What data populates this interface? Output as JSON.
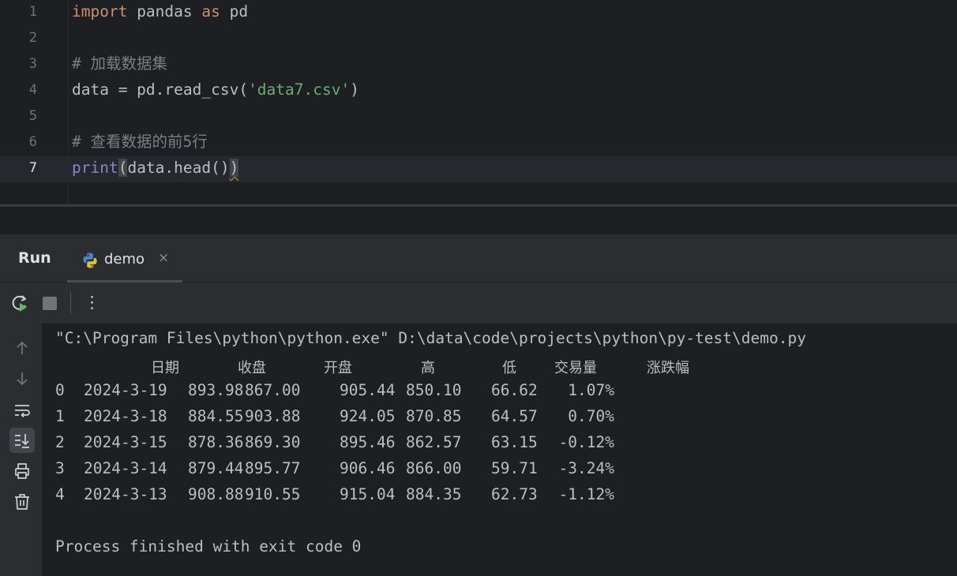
{
  "editor": {
    "lines": [
      {
        "num": "1",
        "tokens": [
          {
            "t": "import",
            "c": "kw"
          },
          {
            "t": " pandas ",
            "c": ""
          },
          {
            "t": "as",
            "c": "kw"
          },
          {
            "t": " pd",
            "c": ""
          }
        ]
      },
      {
        "num": "2",
        "tokens": []
      },
      {
        "num": "3",
        "tokens": [
          {
            "t": "# 加载数据集",
            "c": "comment"
          }
        ]
      },
      {
        "num": "4",
        "tokens": [
          {
            "t": "data = pd.read_csv(",
            "c": ""
          },
          {
            "t": "'data7.csv'",
            "c": "str"
          },
          {
            "t": ")",
            "c": ""
          }
        ]
      },
      {
        "num": "5",
        "tokens": []
      },
      {
        "num": "6",
        "tokens": [
          {
            "t": "# 查看数据的前5行",
            "c": "comment"
          }
        ]
      },
      {
        "num": "7",
        "current": true,
        "tokens": [
          {
            "t": "print",
            "c": "builtin"
          },
          {
            "t": "(",
            "c": "paren-match"
          },
          {
            "t": "data.head()",
            "c": ""
          },
          {
            "t": ")",
            "c": "paren-warn"
          }
        ]
      }
    ]
  },
  "run_panel": {
    "title": "Run",
    "tab_label": "demo",
    "tab_close": "×",
    "more_label": "⋮"
  },
  "console": {
    "command": "\"C:\\Program Files\\python\\python.exe\" D:\\data\\code\\projects\\python\\py-test\\demo.py",
    "headers": [
      "日期",
      "收盘",
      "开盘",
      "高",
      "低",
      "交易量",
      "涨跌幅"
    ],
    "rows": [
      [
        "0",
        "2024-3-19",
        "893.98",
        "867.00",
        "905.44",
        "850.10",
        "66.62",
        "1.07%"
      ],
      [
        "1",
        "2024-3-18",
        "884.55",
        "903.88",
        "924.05",
        "870.85",
        "64.57",
        "0.70%"
      ],
      [
        "2",
        "2024-3-15",
        "878.36",
        "869.30",
        "895.46",
        "862.57",
        "63.15",
        "-0.12%"
      ],
      [
        "3",
        "2024-3-14",
        "879.44",
        "895.77",
        "906.46",
        "866.00",
        "59.71",
        "-3.24%"
      ],
      [
        "4",
        "2024-3-13",
        "908.88",
        "910.55",
        "915.04",
        "884.35",
        "62.73",
        "-1.12%"
      ]
    ],
    "finish_message": "Process finished with exit code 0"
  },
  "colors": {
    "keyword": "#cf8e6d",
    "string": "#6aab73",
    "comment": "#7a7e85",
    "builtin": "#8888c6",
    "background": "#1e1f22",
    "panel": "#2b2d30"
  }
}
